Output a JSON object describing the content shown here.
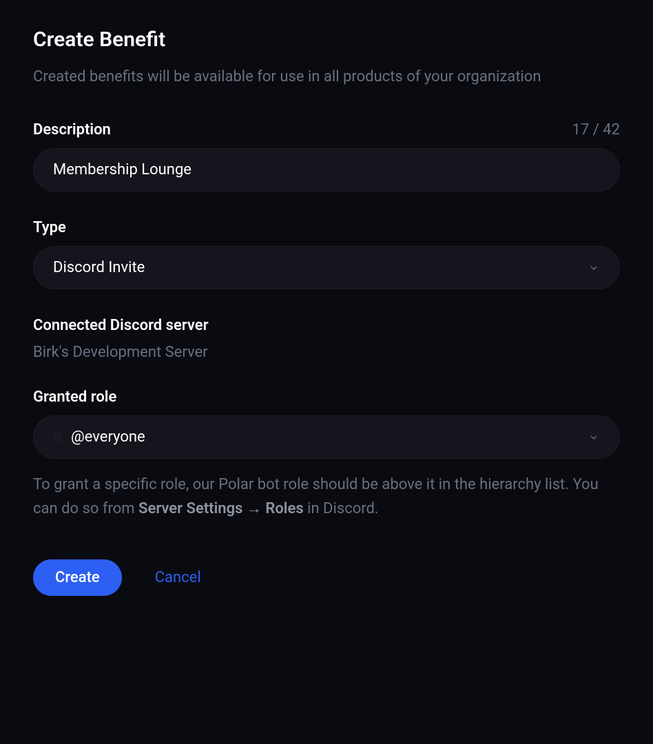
{
  "header": {
    "title": "Create Benefit",
    "subtitle": "Created benefits will be available for use in all products of your organization"
  },
  "form": {
    "description": {
      "label": "Description",
      "value": "Membership Lounge",
      "char_count": "17 / 42"
    },
    "type": {
      "label": "Type",
      "selected": "Discord Invite"
    },
    "connected_server": {
      "label": "Connected Discord server",
      "value": "Birk's Development Server"
    },
    "granted_role": {
      "label": "Granted role",
      "selected": "@everyone",
      "help_prefix": "To grant a specific role, our Polar bot role should be above it in the hierarchy list. You can do so from ",
      "help_strong": "Server Settings → Roles",
      "help_suffix": " in Discord."
    }
  },
  "buttons": {
    "create": "Create",
    "cancel": "Cancel"
  }
}
